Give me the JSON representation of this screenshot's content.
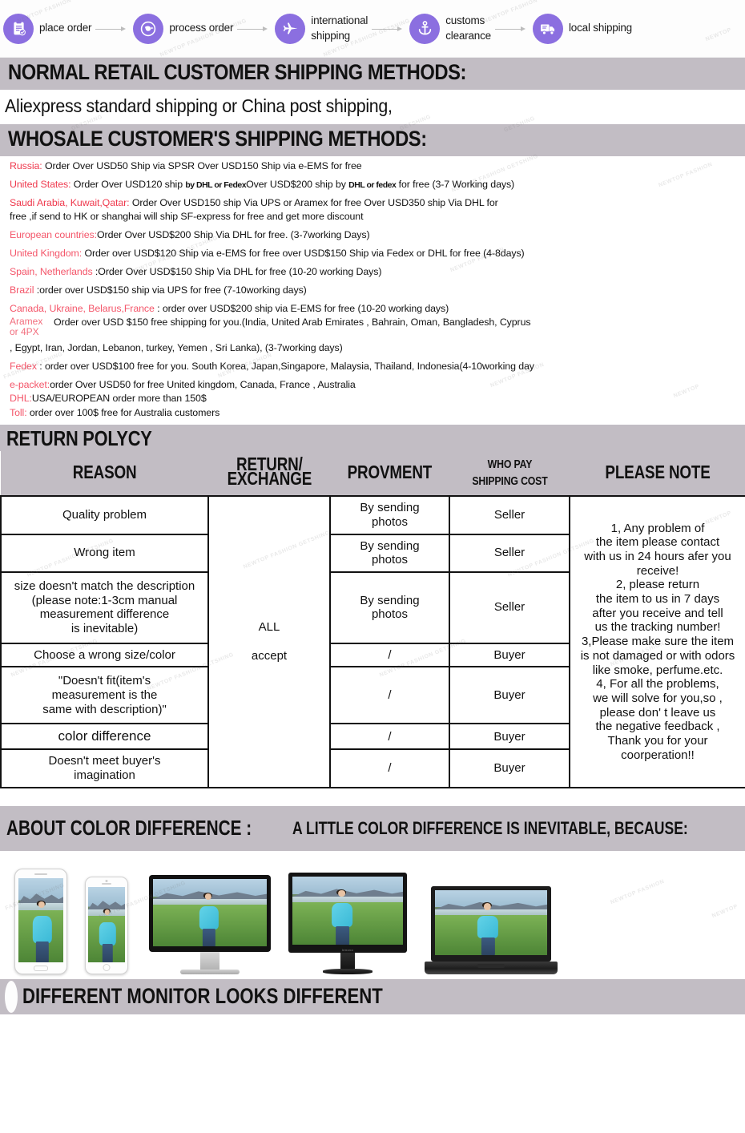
{
  "flow": {
    "steps": [
      {
        "icon": "clipboard-check-icon",
        "label": "place order"
      },
      {
        "icon": "globe-arrow-icon",
        "label": "process order"
      },
      {
        "icon": "airplane-icon",
        "label": "international\nshipping"
      },
      {
        "icon": "anchor-icon",
        "label": "customs\nclearance"
      },
      {
        "icon": "delivery-truck-icon",
        "label": "local shipping"
      }
    ],
    "accent_color": "#8b6fe0"
  },
  "retail": {
    "heading": "NORMAL RETAIL CUSTOMER SHIPPING METHODS:",
    "body": "Aliexpress standard shipping or China post shipping,"
  },
  "wholesale": {
    "heading": "WHOSALE CUSTOMER'S SHIPPING METHODS:",
    "country_color": "#ef3a4e",
    "lines": [
      {
        "country": "Russia:",
        "text": " Order Over USD50 Ship via SPSR   Over USD150 Ship via e-EMS for free"
      },
      {
        "country": "United States:",
        "text": " Order Over USD120 ship by DHL or FedexOver USD$200 ship by DHL or fedex for free (3-7 Working days)"
      },
      {
        "country": "Saudi Arabia, Kuwait,Qatar:",
        "text": " Order  Over USD150 ship Via UPS or Aramex for free    Over USD350  ship Via DHL  for"
      },
      {
        "country": "",
        "text": " free ,if send to HK or shanghai  will ship SF-express for  free and get more discount"
      },
      {
        "country": "European countries:",
        "text": "Order Over USD$200 Ship Via DHL for free. (3-7working Days)"
      },
      {
        "country": "United Kingdom:",
        "text": " Order over USD$120 Ship via e-EMS for free  over USD$150 Ship via Fedex or DHL for free (4-8days)"
      },
      {
        "country": "Spain, Netherlands",
        "text": " :Order Over USD$150 Ship Via   DHL for    free (10-20 working Days)"
      },
      {
        "country": "Brazil",
        "text": " :order over USD$150 ship via UPS  for free (7-10working days)"
      },
      {
        "country": "Canada, Ukraine, Belarus,France",
        "text": " : order  over USD$200 ship via E-EMS for free (10-20 working days)"
      }
    ],
    "aramex": {
      "tag": "Aramex\nor 4PX",
      "line1": "Order over USD $150  free shipping for you.(India, United Arab Emirates ,   Bahrain, Oman, Bangladesh,  Cyprus",
      "line2": ", Egypt, Iran, Jordan, Lebanon, turkey, Yemen , Sri Lanka), (3-7working days)"
    },
    "tail_lines": [
      {
        "country": "Fedex",
        "text": " : order over USD$100  free for you. South Korea, Japan,Singapore, Malaysia, Thailand, Indonesia(4-10working day"
      },
      {
        "country": "e-packet:",
        "text": "order Over USD50 for free  United kingdom, Canada, France , Australia"
      },
      {
        "country": "DHL:",
        "text": "USA/EUROPEAN  order more than 150$"
      },
      {
        "country": "Toll:",
        "text": " order over 100$ free for Australia customers"
      }
    ]
  },
  "return_policy": {
    "heading": "RETURN POLYCY",
    "columns": [
      "REASON",
      "RETURN/\nEXCHANGE",
      "PROVMENT",
      "WHO PAY\nSHIPPING COST",
      "PLEASE NOTE"
    ],
    "exchange_value": "ALL\n\naccept",
    "rows": [
      {
        "reason": "Quality problem",
        "provment": "By sending\nphotos",
        "who_pays": "Seller"
      },
      {
        "reason": "Wrong item",
        "provment": "By sending\nphotos",
        "who_pays": "Seller"
      },
      {
        "reason": "size doesn't match the description\n(please note:1-3cm manual\nmeasurement difference\nis inevitable)",
        "provment": "By sending\nphotos",
        "who_pays": "Seller"
      },
      {
        "reason": "Choose a wrong size/color",
        "provment": "/",
        "who_pays": "Buyer"
      },
      {
        "reason": "\"Doesn't fit(item's\nmeasurement is the\nsame with description)\"",
        "provment": "/",
        "who_pays": "Buyer"
      },
      {
        "reason": "color difference",
        "provment": "/",
        "who_pays": "Buyer"
      },
      {
        "reason": "Doesn't meet buyer's\nimagination",
        "provment": "/",
        "who_pays": "Buyer"
      }
    ],
    "note_lines": [
      "1,  Any problem of",
      "the item please contact",
      "with us in 24 hours afer you",
      "receive!",
      "2, please return",
      "the item to us in 7 days",
      "after you receive and tell",
      "us the tracking number!",
      "3,Please make sure the item",
      "is not damaged or with odors",
      "like smoke, perfume.etc.",
      "4, For all the problems,",
      "we will solve for you,so ,",
      "please don' t leave us",
      "the negative feedback ,",
      "Thank you for your",
      "coorperation!!"
    ]
  },
  "color_difference": {
    "heading_main": "ABOUT COLOR DIFFERENCE :",
    "heading_sub": "A LITTLE COLOR DIFFERENCE IS INEVITABLE, BECAUSE:",
    "devices": [
      "android-phone",
      "iphone",
      "imac-desktop",
      "lcd-monitor",
      "laptop"
    ],
    "monitor_brand": "lenovo",
    "bottom_heading": "DIFFERENT MONITOR LOOKS DIFFERENT"
  },
  "watermark": {
    "text": "NEWTOP FASHION GETSHING",
    "short": "GETSHING"
  },
  "theme": {
    "bar_bg": "#c2bdc4",
    "page_bg": "#ffffff",
    "accent": "#8b6fe0",
    "country_red": "#ef3a4e"
  }
}
